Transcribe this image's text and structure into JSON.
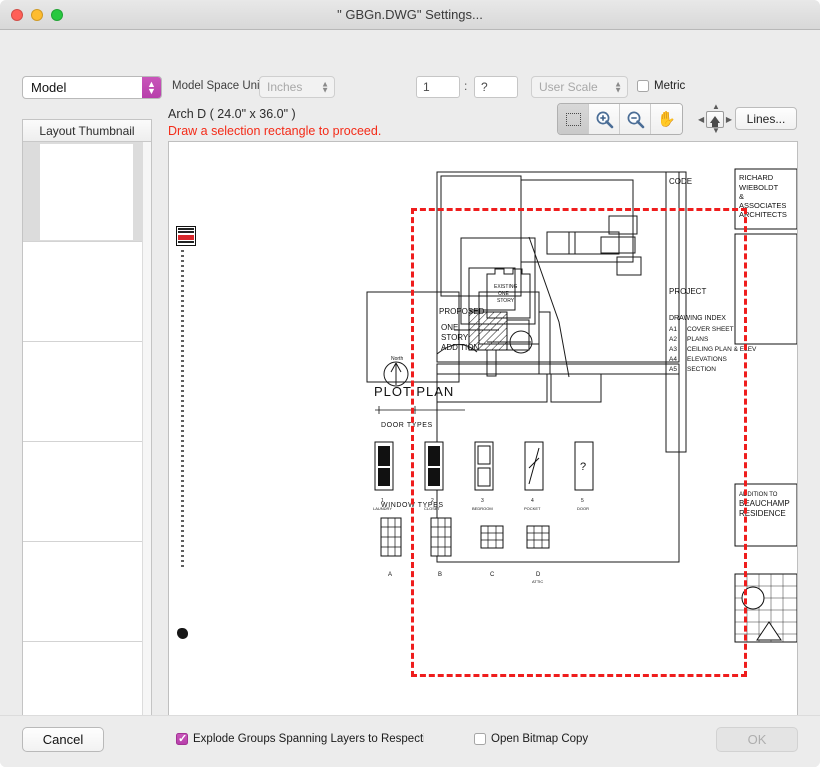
{
  "window": {
    "title": "\" GBGn.DWG\" Settings...",
    "traffic_lights": [
      "close-button",
      "minimize-button",
      "zoom-button"
    ]
  },
  "controls": {
    "layout_popup_value": "Model",
    "model_space_units_label": "Model Space Units",
    "units_popup_value": "Inches",
    "scale_numerator": "1",
    "scale_separator": ":",
    "scale_denominator": "?",
    "user_scale_value": "User Scale",
    "metric_label": "Metric",
    "metric_checked": false
  },
  "sheet": {
    "size_label": "Arch D ( 24.0\" x 36.0\" )",
    "warning": "Draw a selection rectangle to proceed.",
    "warning_color": "#f42b18"
  },
  "toolbar": {
    "tools": [
      {
        "name": "marquee-select-tool",
        "active": true
      },
      {
        "name": "zoom-in-tool",
        "active": false
      },
      {
        "name": "zoom-out-tool",
        "active": false
      },
      {
        "name": "pan-hand-tool",
        "active": false
      }
    ],
    "origin_control_label": "origin-nudge-control",
    "lines_button": "Lines..."
  },
  "sidebar": {
    "header": "Layout Thumbnail",
    "rows": [
      {
        "selected": true
      },
      {
        "selected": false
      },
      {
        "selected": false
      },
      {
        "selected": false
      },
      {
        "selected": false
      },
      {
        "selected": false
      }
    ]
  },
  "drawing": {
    "titleblock_firm": [
      "RICHARD",
      "WIEBOLDT",
      "&",
      "ASSOCIATES",
      "ARCHITECTS"
    ],
    "code_heading": "CODE",
    "project_heading": "PROJECT",
    "drawing_index_heading": "DRAWING INDEX",
    "drawing_index": [
      {
        "num": "A1",
        "title": "COVER SHEET"
      },
      {
        "num": "A2",
        "title": "PLANS"
      },
      {
        "num": "A3",
        "title": "CEILING PLAN & ELEV"
      },
      {
        "num": "A4",
        "title": "ELEVATIONS"
      },
      {
        "num": "A5",
        "title": "SECTION"
      }
    ],
    "plot_plan_label": "PLOT  PLAN",
    "proposed_label": "PROPOSED",
    "addition_lines": [
      "ONE",
      "STORY",
      "ADDITION"
    ],
    "existing_lines": [
      "EXISTING",
      "ONE",
      "STORY"
    ],
    "north_label": "North",
    "door_types_label": "DOOR  TYPES",
    "window_types_label": "WINDOW  TYPES",
    "door_types": [
      {
        "num": "1",
        "name": "LAUNDRY"
      },
      {
        "num": "2",
        "name": "CLOSET"
      },
      {
        "num": "3",
        "name": "BEDROOM"
      },
      {
        "num": "4",
        "name": "POCKET"
      },
      {
        "num": "5",
        "name": "DOOR"
      }
    ],
    "window_types": [
      {
        "letter": "A"
      },
      {
        "letter": "B"
      },
      {
        "letter": "C"
      },
      {
        "letter": "D"
      }
    ],
    "project_titleblock": [
      "ADDITION  TO",
      "BEAUCHAMP",
      "RESIDENCE"
    ],
    "selection_color": "#ef1d1d"
  },
  "footer": {
    "cancel_label": "Cancel",
    "ok_label": "OK",
    "ok_enabled": false,
    "explode_label": "Explode Groups Spanning Layers to Respective Layers",
    "explode_checked": true,
    "bitmap_label": "Open Bitmap Copy",
    "bitmap_checked": false
  }
}
